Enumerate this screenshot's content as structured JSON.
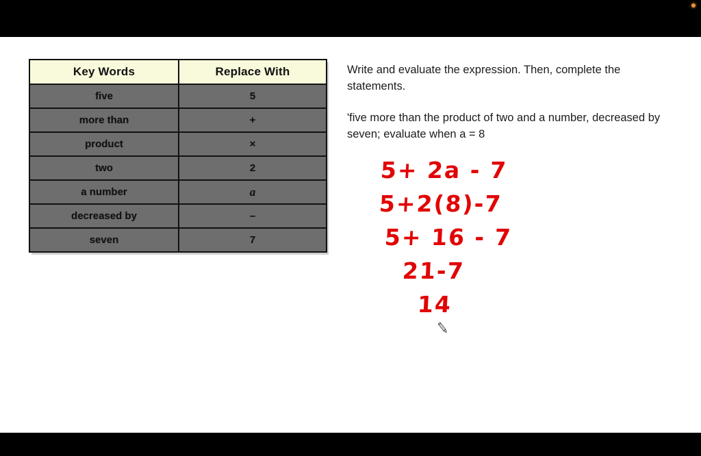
{
  "slide": {
    "table": {
      "title_columns": [
        "Key Words",
        "Replace With"
      ],
      "rows": [
        {
          "key_word": "five",
          "replace_with": "5",
          "is_variable": false
        },
        {
          "key_word": "more than",
          "replace_with": "+",
          "is_variable": false
        },
        {
          "key_word": "product",
          "replace_with": "×",
          "is_variable": false
        },
        {
          "key_word": "two",
          "replace_with": "2",
          "is_variable": false
        },
        {
          "key_word": "a number",
          "replace_with": "a",
          "is_variable": true
        },
        {
          "key_word": "decreased by",
          "replace_with": "–",
          "is_variable": false
        },
        {
          "key_word": "seven",
          "replace_with": "7",
          "is_variable": false
        }
      ],
      "header_bg": "#f9f9dc",
      "row_bg": "#6e6e6e",
      "border_color": "#111111"
    },
    "prompt": {
      "instruction": "Write and evaluate the expression. Then, complete the statements.",
      "problem": "'five more than the product of two and a number, decreased by seven; evaluate when a = 8"
    },
    "handwriting": {
      "color": "#e10505",
      "lines": [
        "5+ 2a - 7",
        "5+2(8)-7",
        "5+ 16 - 7",
        "21-7",
        "14"
      ]
    },
    "cursor": {
      "icon": "pencil-cursor"
    }
  }
}
